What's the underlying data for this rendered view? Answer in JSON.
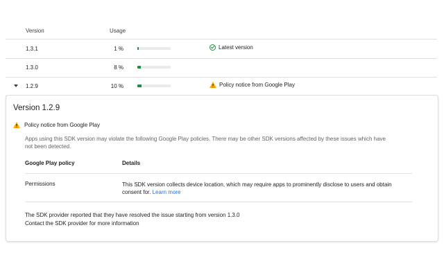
{
  "table": {
    "headers": {
      "version": "Version",
      "usage": "Usage"
    },
    "rows": [
      {
        "version": "1.3.1",
        "usage": "1 %",
        "usage_fraction": 0.01,
        "status": "Latest version",
        "status_icon": "check-circle-icon"
      },
      {
        "version": "1.3.0",
        "usage": "8 %",
        "usage_fraction": 0.08,
        "status": "",
        "status_icon": ""
      },
      {
        "version": "1.2.9",
        "usage": "10 %",
        "usage_fraction": 0.1,
        "status": "Policy notice from Google Play",
        "status_icon": "warning-icon",
        "expanded": true
      }
    ]
  },
  "detail": {
    "title": "Version 1.2.9",
    "notice_title": "Policy notice from Google Play",
    "notice_description": "Apps using this SDK version may violate the following Google Play policies. There may be other SDK versions affected by these issues which have not been detected.",
    "policy_table": {
      "headers": {
        "policy": "Google Play policy",
        "details": "Details"
      },
      "rows": [
        {
          "policy": "Permissions",
          "details": "This SDK version collects device location, which may require apps to prominently disclose to users and obtain consent for.",
          "link": "Learn more"
        }
      ]
    },
    "footer_line1": "The SDK provider reported that they have resolved the issue starting from version 1.3.0",
    "footer_line2": "Contact the SDK provider for more information"
  },
  "colors": {
    "green": "#1e8e3e",
    "warning": "#f9ab00",
    "link": "#1a73e8",
    "bar_bg": "#e8eaed",
    "divider": "#e0e0e0"
  }
}
